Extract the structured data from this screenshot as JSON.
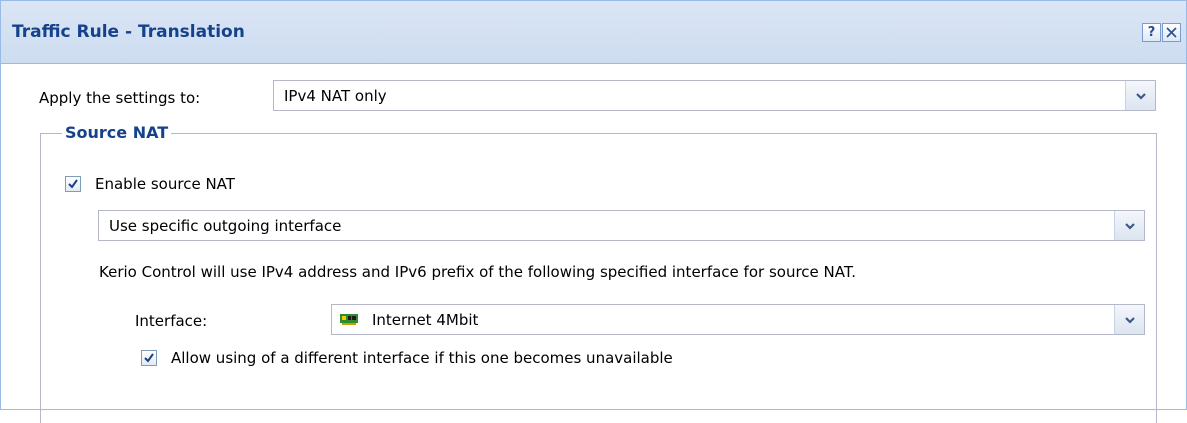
{
  "dialog": {
    "title": "Traffic Rule - Translation",
    "help_icon": "?",
    "close_icon": "close-icon",
    "apply": {
      "label": "Apply the settings to:",
      "value": "IPv4 NAT only"
    },
    "source_nat": {
      "legend": "Source NAT",
      "enable": {
        "label": "Enable source NAT",
        "checked": true
      },
      "mode_value": "Use specific outgoing interface",
      "description": "Kerio Control will use IPv4 address and IPv6 prefix of the following specified interface for source NAT.",
      "interface": {
        "label": "Interface:",
        "value": "Internet 4Mbit",
        "icon": "network-card-icon"
      },
      "allow_fallback": {
        "label": "Allow using of a different interface if this one becomes unavailable",
        "checked": true
      }
    },
    "colors": {
      "title": "#15428b",
      "header_bg": "#d4e1f2",
      "border": "#99bbe8"
    }
  }
}
